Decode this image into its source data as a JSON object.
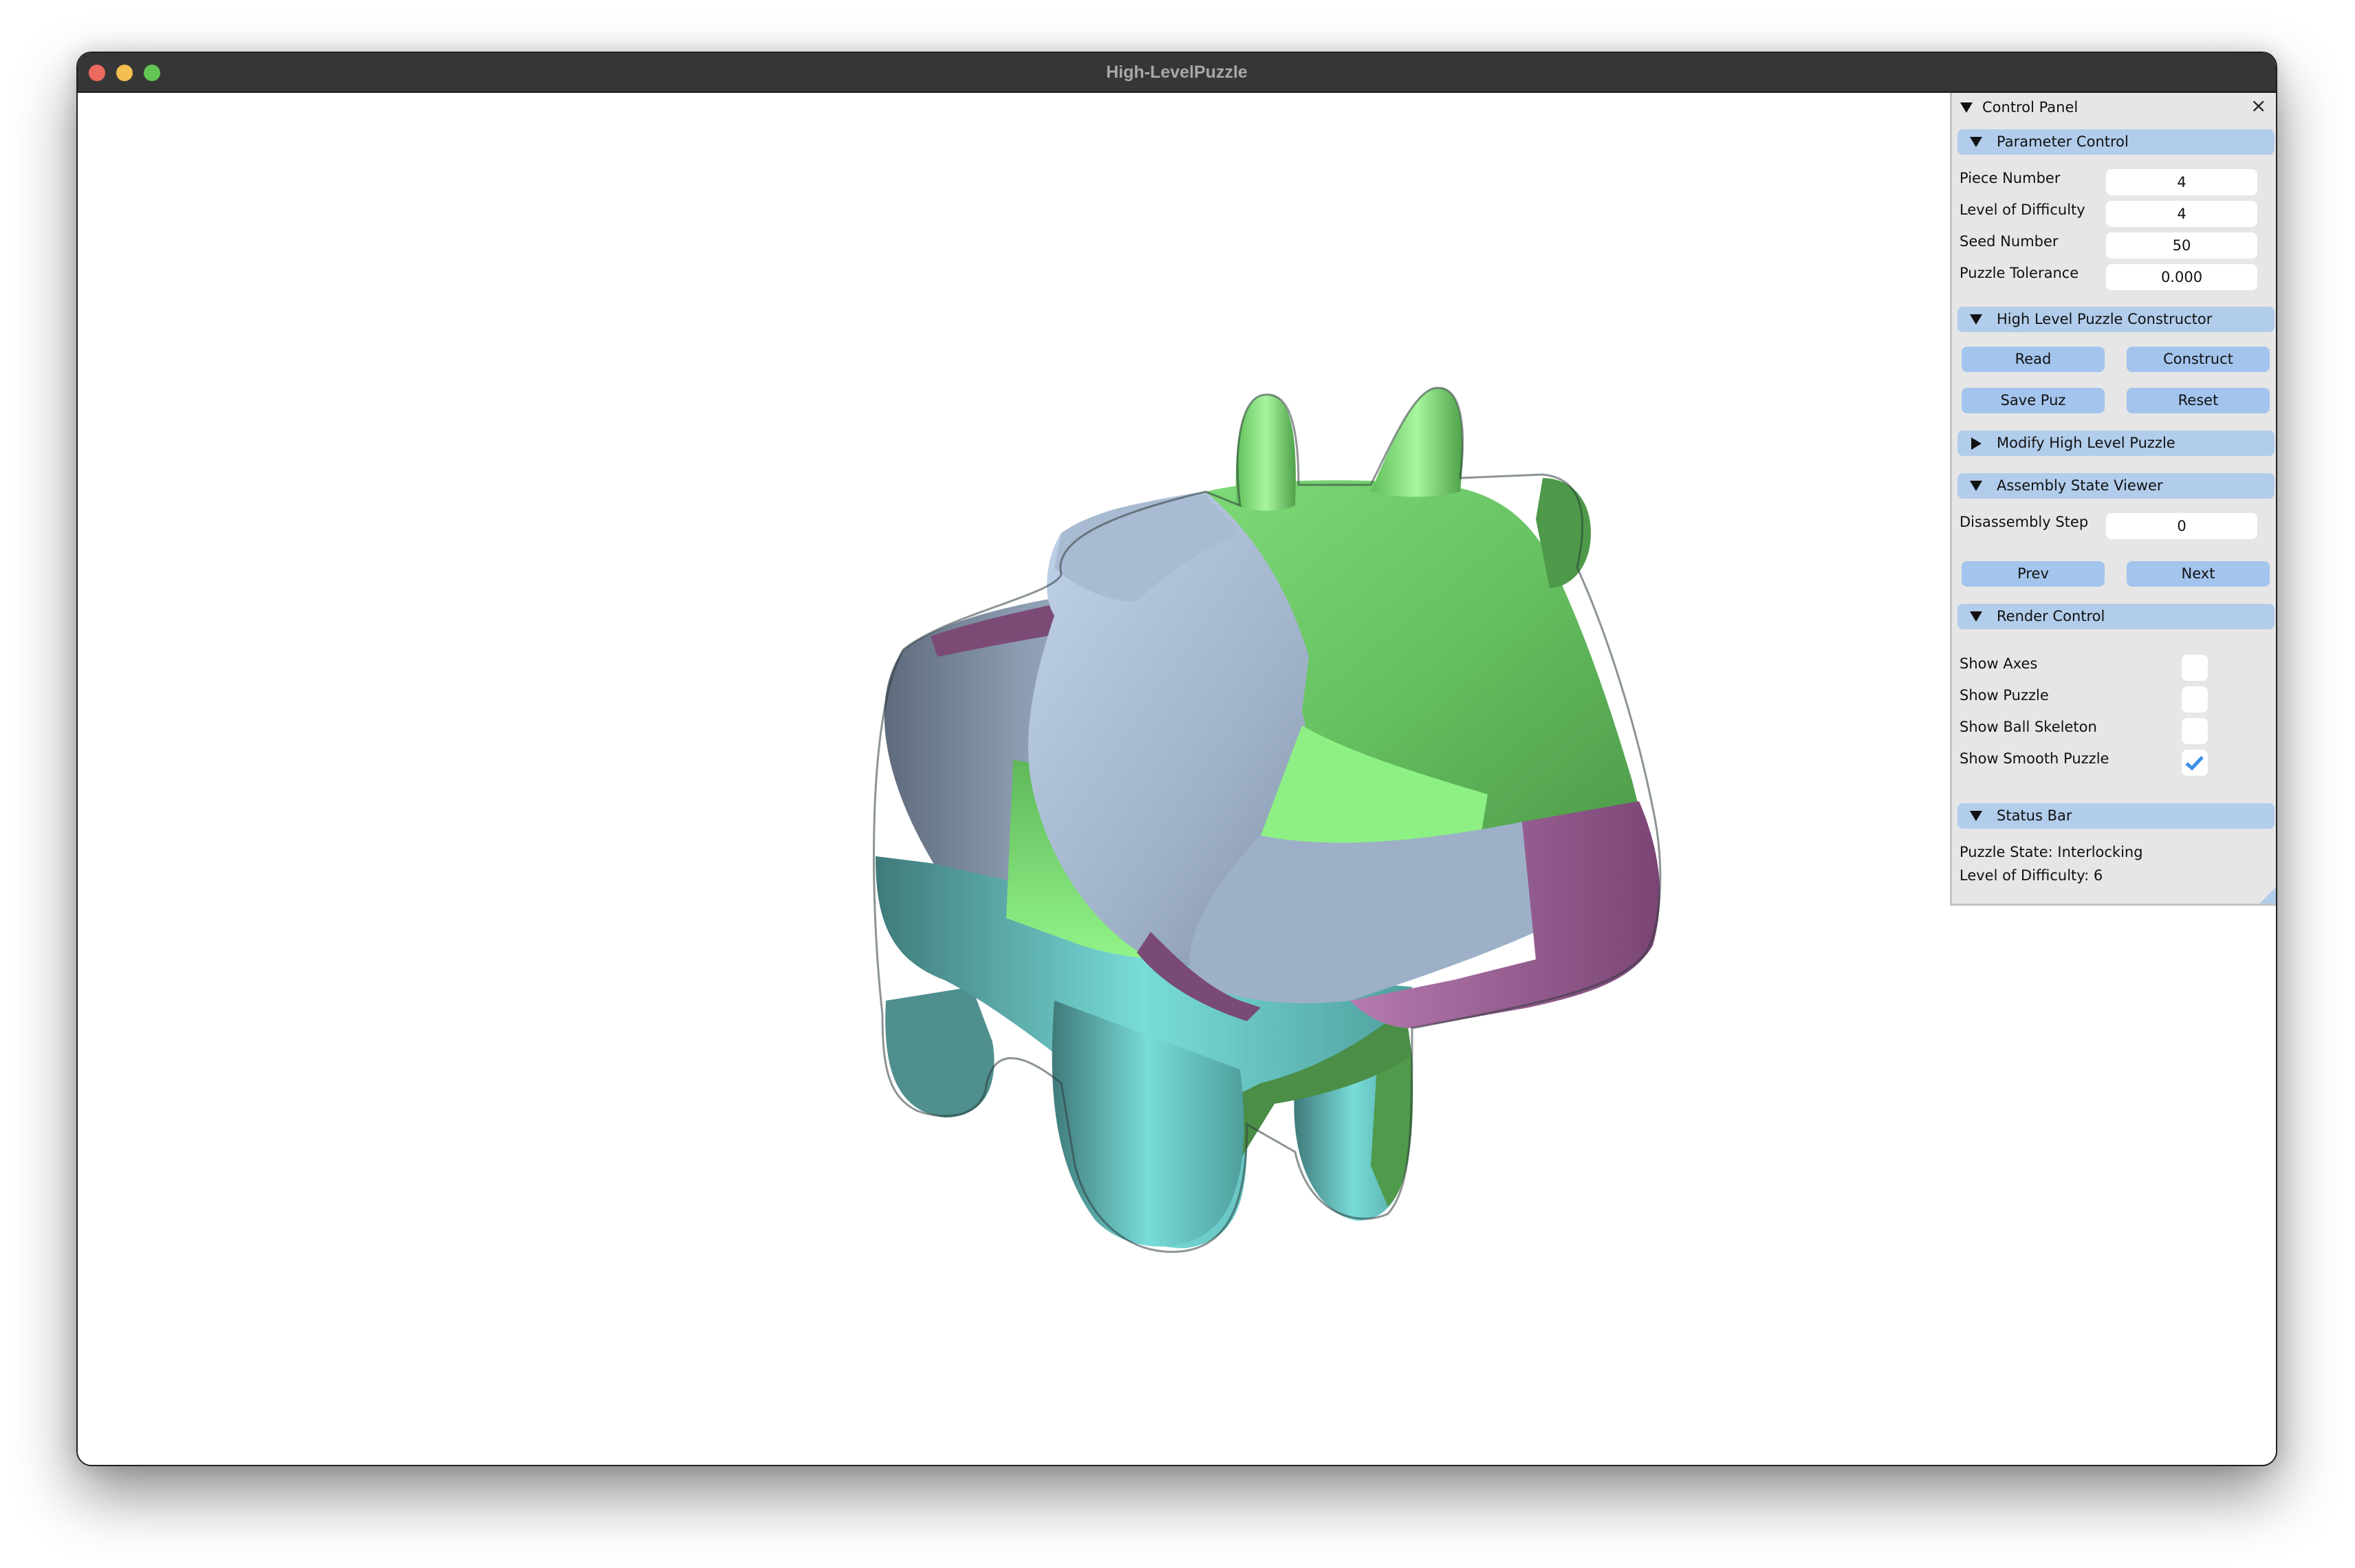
{
  "window": {
    "title": "High-LevelPuzzle",
    "traffic_lights": [
      "close",
      "minimize",
      "maximize"
    ]
  },
  "scene": {
    "model": "cow",
    "piece_colors": {
      "blue_gray": "#9fb1c8",
      "green": "#74d16e",
      "magenta": "#a86aa3",
      "cyan": "#6ccbc8"
    }
  },
  "panel": {
    "title": "Control Panel",
    "close_icon": "×",
    "sections": {
      "parameter_control": {
        "label": "Parameter Control",
        "fields": [
          {
            "label": "Piece Number",
            "value": "4"
          },
          {
            "label": "Level of Difficulty",
            "value": "4"
          },
          {
            "label": "Seed Number",
            "value": "50"
          },
          {
            "label": "Puzzle Tolerance",
            "value": "0.000"
          }
        ]
      },
      "constructor": {
        "label": "High Level Puzzle Constructor",
        "buttons": {
          "read": "Read",
          "construct": "Construct",
          "save": "Save Puz",
          "reset": "Reset"
        }
      },
      "modify": {
        "label": "Modify High Level Puzzle",
        "collapsed": true
      },
      "assembly": {
        "label": "Assembly State Viewer",
        "step_label": "Disassembly Step",
        "step_value": "0",
        "prev": "Prev",
        "next": "Next"
      },
      "render": {
        "label": "Render Control",
        "options": [
          {
            "label": "Show Axes",
            "checked": false
          },
          {
            "label": "Show Puzzle",
            "checked": false
          },
          {
            "label": "Show Ball Skeleton",
            "checked": false
          },
          {
            "label": "Show Smooth Puzzle",
            "checked": true
          }
        ]
      },
      "status": {
        "label": "Status Bar",
        "puzzle_state": "Puzzle State: Interlocking",
        "level": "Level of Difficulty: 6"
      }
    }
  },
  "colors": {
    "section_header": "#b2cdeb",
    "button": "#a3c4ec",
    "panel_bg": "#e6e6e6",
    "checkmark": "#3d8ee8"
  }
}
